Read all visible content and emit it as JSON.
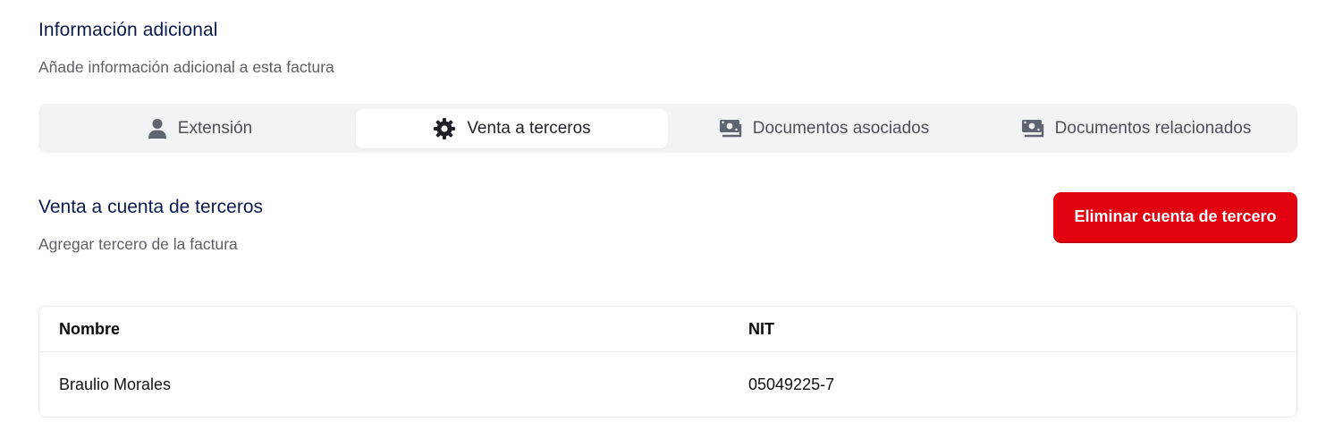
{
  "section": {
    "title": "Información adicional",
    "subtitle": "Añade información adicional a esta factura"
  },
  "tabs": [
    {
      "label": "Extensión",
      "icon": "user-icon",
      "active": false
    },
    {
      "label": "Venta a terceros",
      "icon": "gear-icon",
      "active": true
    },
    {
      "label": "Documentos asociados",
      "icon": "money-bill-icon",
      "active": false
    },
    {
      "label": "Documentos relacionados",
      "icon": "money-bill-icon",
      "active": false
    }
  ],
  "third_party": {
    "title": "Venta a cuenta de terceros",
    "subtitle": "Agregar tercero de la factura",
    "delete_button": "Eliminar cuenta de tercero"
  },
  "table": {
    "headers": [
      "Nombre",
      "NIT"
    ],
    "rows": [
      [
        "Braulio Morales",
        "05049225-7"
      ]
    ]
  },
  "colors": {
    "heading": "#0b1a4f",
    "danger": "#e3000f",
    "tab_bg": "#f2f3f5"
  }
}
